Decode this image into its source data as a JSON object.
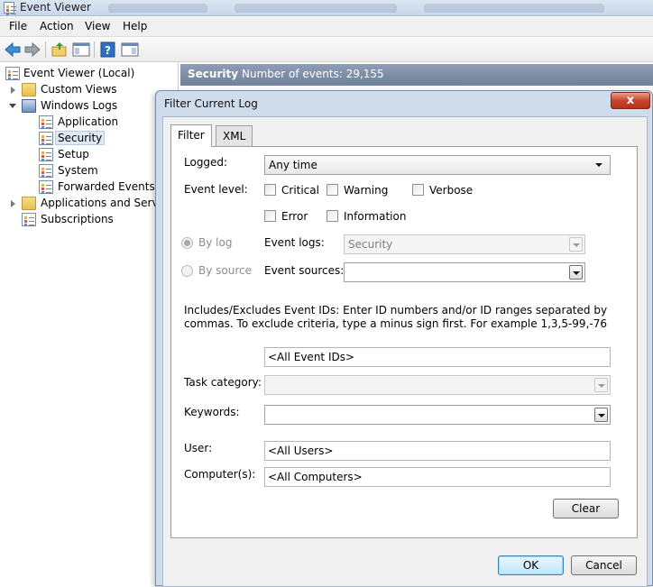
{
  "window": {
    "title": "Event Viewer"
  },
  "menu": [
    "File",
    "Action",
    "View",
    "Help"
  ],
  "tree": {
    "root": "Event Viewer (Local)",
    "custom_views": "Custom Views",
    "windows_logs": "Windows Logs",
    "logs": [
      "Application",
      "Security",
      "Setup",
      "System",
      "Forwarded Events"
    ],
    "apps_services": "Applications and Services",
    "subscriptions": "Subscriptions"
  },
  "pane": {
    "title": "Security",
    "count": "Number of events: 29,155"
  },
  "dialog": {
    "title": "Filter Current Log",
    "close": "x",
    "tabs": [
      "Filter",
      "XML"
    ],
    "logged_label": "Logged:",
    "logged_value": "Any time",
    "event_level_label": "Event level:",
    "levels": {
      "critical": "Critical",
      "warning": "Warning",
      "verbose": "Verbose",
      "error": "Error",
      "information": "Information"
    },
    "by_log": "By log",
    "by_source": "By source",
    "event_logs_label": "Event logs:",
    "event_logs_value": "Security",
    "event_sources_label": "Event sources:",
    "event_sources_value": "",
    "ids_description": "Includes/Excludes Event IDs: Enter ID numbers and/or ID ranges separated by commas. To exclude criteria, type a minus sign first. For example 1,3,5-99,-76",
    "ids_value": "<All Event IDs>",
    "task_category_label": "Task category:",
    "keywords_label": "Keywords:",
    "user_label": "User:",
    "user_value": "<All Users>",
    "computer_label": "Computer(s):",
    "computer_value": "<All Computers>",
    "clear": "Clear",
    "ok": "OK",
    "cancel": "Cancel"
  }
}
